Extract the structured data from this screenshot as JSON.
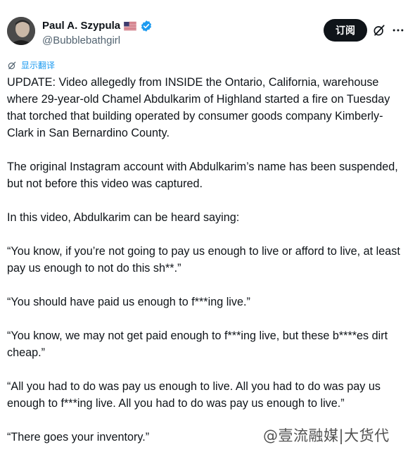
{
  "author": {
    "name": "Paul A. Szypula",
    "handle": "@Bubblebathgirl",
    "flag_icon": "us-flag-icon",
    "verified_icon": "verified-badge-icon"
  },
  "actions": {
    "subscribe_label": "订阅",
    "grok_icon": "grok-icon",
    "more_icon": "more-options-icon"
  },
  "translate": {
    "label": "显示翻译",
    "icon": "translate-icon"
  },
  "tweet": {
    "paragraphs": [
      "UPDATE: Video allegedly from INSIDE the Ontario, California, warehouse where 29-year-old Chamel Abdulkarim of Highland started a fire on Tuesday that torched that building operated by consumer goods company Kimberly-Clark in San Bernardino County.",
      "The original Instagram account with Abdulkarim’s name has been suspended, but not before this video was captured.",
      "In this video, Abdulkarim can be heard saying:",
      "“You know, if you’re not going to pay us enough to live or afford to live, at least pay us enough to not do this sh**.”",
      "“You should have paid us enough to f***ing live.”",
      "“You know, we may not get paid enough to f***ing live, but these b****es dirt cheap.”",
      "“All you had to do was pay us enough to live. All you had to do was pay us enough to f***ing live. All you had to do was pay us enough to live.”",
      "“There goes your inventory.”"
    ]
  },
  "watermark": "@壹流融媒|大货代",
  "colors": {
    "link": "#1d9bf0",
    "verified": "#1d9bf0",
    "text": "#0f1419",
    "secondary": "#536471",
    "button_bg": "#0f1419"
  }
}
